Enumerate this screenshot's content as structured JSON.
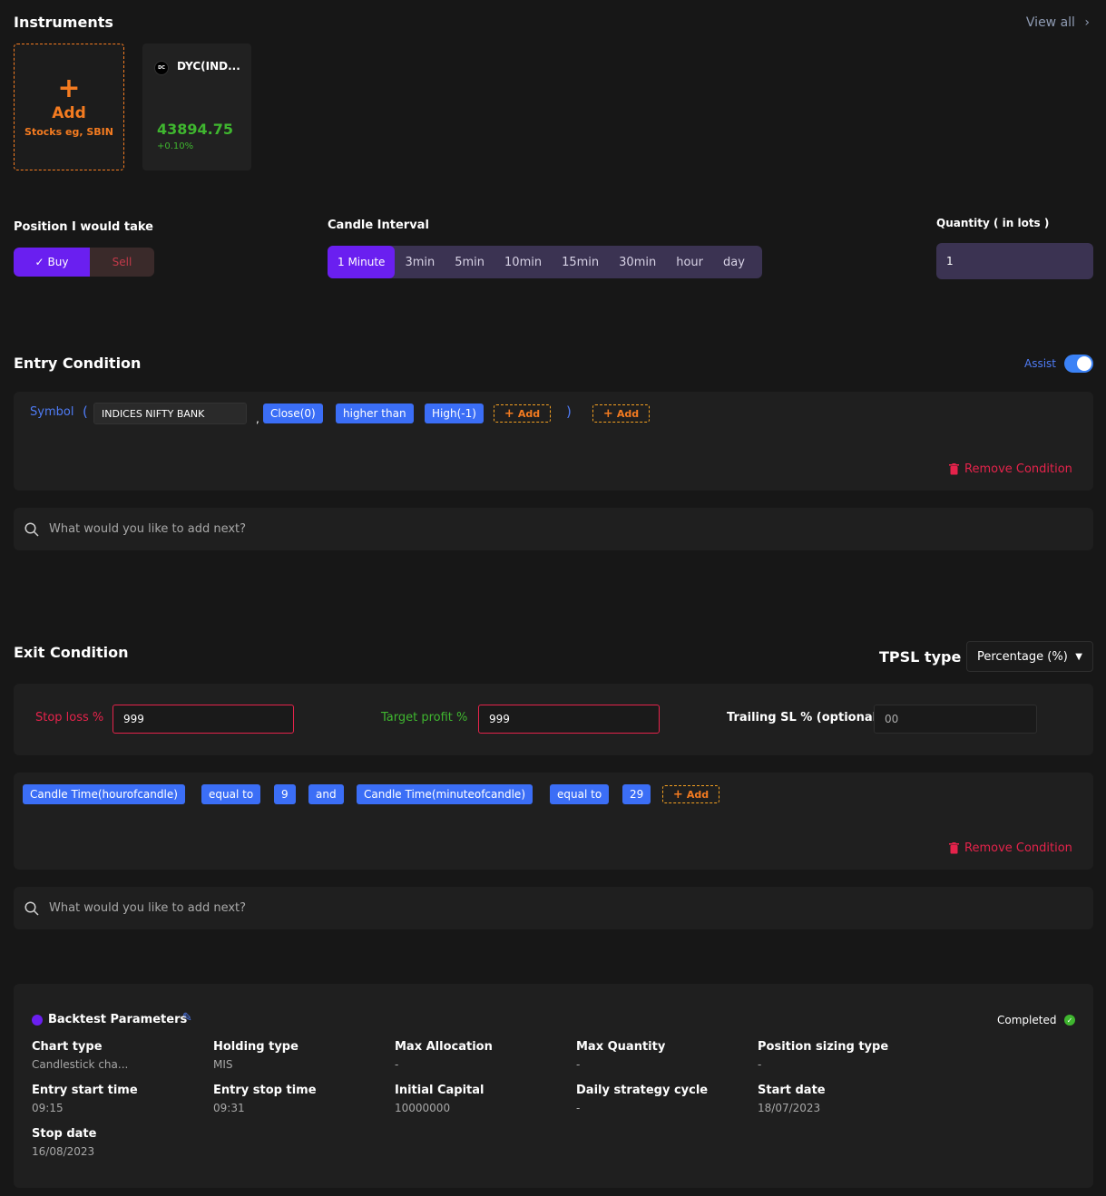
{
  "instruments": {
    "title": "Instruments",
    "view_all": "View all",
    "add_card": {
      "plus": "+",
      "title": "Add",
      "subtitle": "Stocks eg, SBIN"
    },
    "items": [
      {
        "logo": "DC",
        "name": "DYC(IND...",
        "price": "43894.75",
        "change": "+0.10%"
      }
    ]
  },
  "position": {
    "label": "Position I would take",
    "buy": "Buy",
    "sell": "Sell",
    "selected": "Buy"
  },
  "candle_interval": {
    "label": "Candle Interval",
    "options": [
      "1 Minute",
      "3min",
      "5min",
      "10min",
      "15min",
      "30min",
      "hour",
      "day"
    ],
    "selected": "1 Minute"
  },
  "quantity": {
    "label": "Quantity ( in lots )",
    "value": "1"
  },
  "entry": {
    "title": "Entry Condition",
    "assist_label": "Assist",
    "assist_on": true,
    "symbol_label": "Symbol",
    "open_paren": "(",
    "close_paren": ")",
    "comma": ",",
    "symbol_value": "INDICES NIFTY BANK",
    "chips": [
      "Close(0)",
      "higher than",
      "High(-1)"
    ],
    "add_label": "Add",
    "remove_label": "Remove Condition",
    "search_placeholder": "What would you like to add next?"
  },
  "exit": {
    "title": "Exit Condition",
    "tpsl_label": "TPSL type",
    "tpsl_value": "Percentage (%)",
    "stop_loss_label": "Stop loss %",
    "stop_loss_value": "999",
    "target_label": "Target profit %",
    "target_value": "999",
    "trailing_label": "Trailing SL % (optional)",
    "trailing_placeholder": "00",
    "chips": [
      "Candle Time(hourofcandle)",
      "equal to",
      "9",
      "and",
      "Candle Time(minuteofcandle)",
      "equal to",
      "29"
    ],
    "add_label": "Add",
    "remove_label": "Remove Condition",
    "search_placeholder": "What would you like to add next?"
  },
  "backtest": {
    "title": "Backtest Parameters",
    "status": "Completed",
    "params": [
      {
        "key": "Chart type",
        "value": "Candlestick cha..."
      },
      {
        "key": "Holding type",
        "value": "MIS"
      },
      {
        "key": "Max Allocation",
        "value": "-"
      },
      {
        "key": "Max Quantity",
        "value": "-"
      },
      {
        "key": "Position sizing type",
        "value": "-"
      },
      {
        "key": "Entry start time",
        "value": "09:15"
      },
      {
        "key": "Entry stop time",
        "value": "09:31"
      },
      {
        "key": "Initial Capital",
        "value": "10000000"
      },
      {
        "key": "Daily strategy cycle",
        "value": "-"
      },
      {
        "key": "Start date",
        "value": "18/07/2023"
      },
      {
        "key": "Stop date",
        "value": "16/08/2023"
      }
    ]
  },
  "colors": {
    "accent": "#6a1ff0",
    "chip": "#3b6ef6",
    "danger": "#e5234b",
    "success": "#3fb62f",
    "add": "#f47b20"
  }
}
